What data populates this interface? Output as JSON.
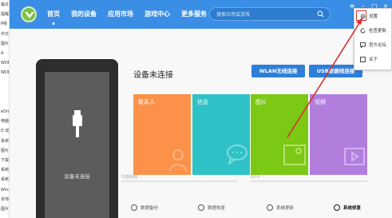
{
  "background_strip": {
    "items": [
      "最近",
      "提醒",
      "P组",
      "中文电",
      "图片",
      "A",
      "WDR",
      "WDR",
      "",
      "",
      "",
      "eDm",
      "电脑",
      "D 动",
      "系统",
      "图片",
      "下载",
      "系统",
      "系统",
      "Wind",
      "本地",
      "图片"
    ]
  },
  "header": {
    "nav": [
      {
        "label": "首页",
        "active": true
      },
      {
        "label": "我的设备",
        "active": false
      },
      {
        "label": "应用市场",
        "active": false
      },
      {
        "label": "游戏中心",
        "active": false
      },
      {
        "label": "更多服务",
        "active": false
      }
    ],
    "search_placeholder": "搜索应用或游戏"
  },
  "phone": {
    "screen_text": "设备未连接"
  },
  "main": {
    "status_title": "设备未连接",
    "wlan_button": "WLAN无线连接",
    "usb_button": "USB数据线连接",
    "tiles": [
      {
        "label": "联系人",
        "color": "#fc924a"
      },
      {
        "label": "信息",
        "color": "#2ec2c6"
      },
      {
        "label": "图片",
        "color": "#7bc815"
      },
      {
        "label": "视频",
        "color": "#b17ede"
      }
    ],
    "storage_internal_label": "内部存储",
    "storage_sd_label": "SD卡"
  },
  "bottom": {
    "backup": "数据备份",
    "restore": "数据恢复",
    "update": "系统更新",
    "repair": "系统修复"
  },
  "menu": {
    "items": [
      {
        "label": "设置",
        "icon": "gear-icon"
      },
      {
        "label": "检查更新",
        "icon": "refresh-icon"
      },
      {
        "label": "官方论坛",
        "icon": "chat-icon"
      },
      {
        "label": "关于",
        "icon": "info-icon"
      }
    ]
  },
  "colors": {
    "header": "#3a8ee6",
    "button": "#2f7fd8",
    "highlight": "#d93030"
  }
}
